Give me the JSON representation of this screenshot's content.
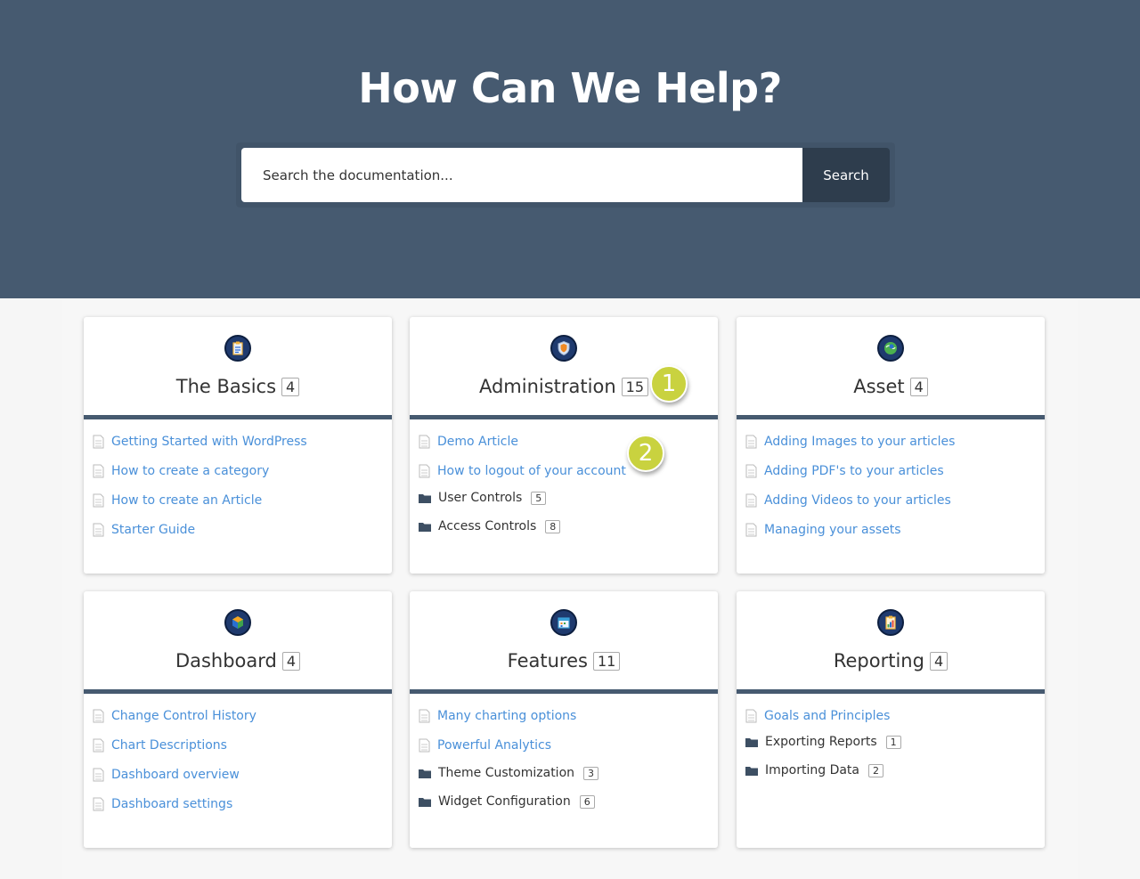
{
  "hero": {
    "title": "How Can We Help?",
    "search_placeholder": "Search the documentation...",
    "search_button": "Search"
  },
  "colors": {
    "hero_bg": "#465a70",
    "search_button_bg": "#2e3d4d",
    "link": "#4a90d9",
    "marker": "#c9d23f"
  },
  "cards": [
    {
      "title": "The Basics",
      "count": "4",
      "icon": "clipboard-icon",
      "articles": [
        "Getting Started with WordPress",
        "How to create a category",
        "How to create an Article",
        "Starter Guide"
      ],
      "categories": []
    },
    {
      "title": "Administration",
      "count": "15",
      "icon": "shield-icon",
      "articles": [
        "Demo Article",
        "How to logout of your account"
      ],
      "categories": [
        {
          "label": "User Controls",
          "count": "5"
        },
        {
          "label": "Access Controls",
          "count": "8"
        }
      ]
    },
    {
      "title": "Asset",
      "count": "4",
      "icon": "globe-icon",
      "articles": [
        "Adding Images to your articles",
        "Adding PDF's to your articles",
        "Adding Videos to your articles",
        "Managing your assets"
      ],
      "categories": []
    },
    {
      "title": "Dashboard",
      "count": "4",
      "icon": "cube-icon",
      "articles": [
        "Change Control History",
        "Chart Descriptions",
        "Dashboard overview",
        "Dashboard settings"
      ],
      "categories": []
    },
    {
      "title": "Features",
      "count": "11",
      "icon": "calendar-icon",
      "articles": [
        "Many charting options",
        "Powerful Analytics"
      ],
      "categories": [
        {
          "label": "Theme Customization",
          "count": "3"
        },
        {
          "label": "Widget Configuration",
          "count": "6"
        }
      ]
    },
    {
      "title": "Reporting",
      "count": "4",
      "icon": "chart-clipboard-icon",
      "articles": [
        "Goals and Principles"
      ],
      "categories": [
        {
          "label": "Exporting Reports",
          "count": "1"
        },
        {
          "label": "Importing Data",
          "count": "2"
        }
      ]
    }
  ],
  "markers": [
    "1",
    "2"
  ]
}
